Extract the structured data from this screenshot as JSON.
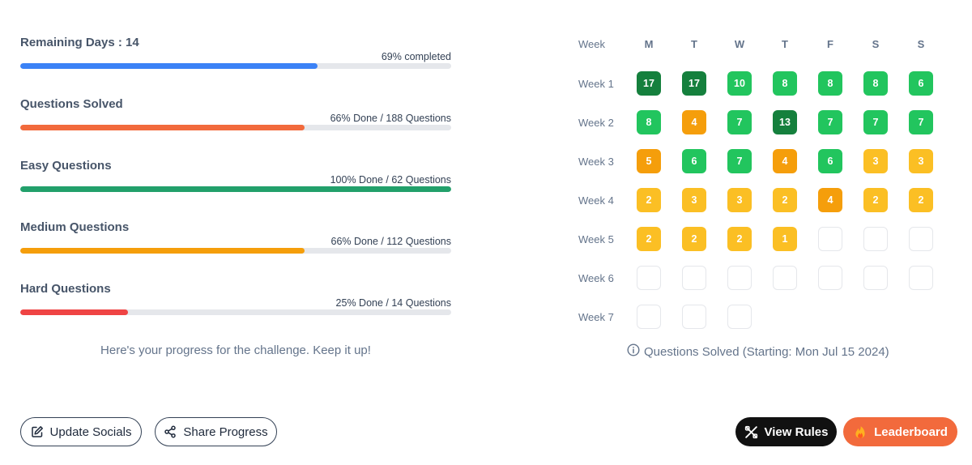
{
  "progress": [
    {
      "title": "Remaining Days : 14",
      "subtitle": "69% completed",
      "percent": 69,
      "color": "#3b82f6"
    },
    {
      "title": "Questions Solved",
      "subtitle": "66% Done / 188 Questions",
      "percent": 66,
      "color": "#f26a3c"
    },
    {
      "title": "Easy Questions",
      "subtitle": "100% Done / 62 Questions",
      "percent": 100,
      "color": "#22a06b"
    },
    {
      "title": "Medium Questions",
      "subtitle": "66% Done / 112 Questions",
      "percent": 66,
      "color": "#f59e0b"
    },
    {
      "title": "Hard Questions",
      "subtitle": "25% Done / 14 Questions",
      "percent": 25,
      "color": "#ef4444"
    }
  ],
  "encouragement": "Here's your progress for the challenge. Keep it up!",
  "calendar": {
    "header_label": "Week",
    "days": [
      "M",
      "T",
      "W",
      "T",
      "F",
      "S",
      "S"
    ],
    "weeks": [
      {
        "label": "Week 1",
        "cells": [
          {
            "v": "17",
            "l": "dark"
          },
          {
            "v": "17",
            "l": "dark"
          },
          {
            "v": "10",
            "l": "green"
          },
          {
            "v": "8",
            "l": "green"
          },
          {
            "v": "8",
            "l": "green"
          },
          {
            "v": "8",
            "l": "green"
          },
          {
            "v": "6",
            "l": "green"
          }
        ]
      },
      {
        "label": "Week 2",
        "cells": [
          {
            "v": "8",
            "l": "green"
          },
          {
            "v": "4",
            "l": "orange"
          },
          {
            "v": "7",
            "l": "green"
          },
          {
            "v": "13",
            "l": "dark"
          },
          {
            "v": "7",
            "l": "green"
          },
          {
            "v": "7",
            "l": "green"
          },
          {
            "v": "7",
            "l": "green"
          }
        ]
      },
      {
        "label": "Week 3",
        "cells": [
          {
            "v": "5",
            "l": "orange"
          },
          {
            "v": "6",
            "l": "green"
          },
          {
            "v": "7",
            "l": "green"
          },
          {
            "v": "4",
            "l": "orange"
          },
          {
            "v": "6",
            "l": "green"
          },
          {
            "v": "3",
            "l": "yellow"
          },
          {
            "v": "3",
            "l": "yellow"
          }
        ]
      },
      {
        "label": "Week 4",
        "cells": [
          {
            "v": "2",
            "l": "yellow"
          },
          {
            "v": "3",
            "l": "yellow"
          },
          {
            "v": "3",
            "l": "yellow"
          },
          {
            "v": "2",
            "l": "yellow"
          },
          {
            "v": "4",
            "l": "orange"
          },
          {
            "v": "2",
            "l": "yellow"
          },
          {
            "v": "2",
            "l": "yellow"
          }
        ]
      },
      {
        "label": "Week 5",
        "cells": [
          {
            "v": "2",
            "l": "yellow"
          },
          {
            "v": "2",
            "l": "yellow"
          },
          {
            "v": "2",
            "l": "yellow"
          },
          {
            "v": "1",
            "l": "yellow"
          },
          {
            "v": "",
            "l": "empty"
          },
          {
            "v": "",
            "l": "empty"
          },
          {
            "v": "",
            "l": "empty"
          }
        ]
      },
      {
        "label": "Week 6",
        "cells": [
          {
            "v": "",
            "l": "empty"
          },
          {
            "v": "",
            "l": "empty"
          },
          {
            "v": "",
            "l": "empty"
          },
          {
            "v": "",
            "l": "empty"
          },
          {
            "v": "",
            "l": "empty"
          },
          {
            "v": "",
            "l": "empty"
          },
          {
            "v": "",
            "l": "empty"
          }
        ]
      },
      {
        "label": "Week 7",
        "cells": [
          {
            "v": "",
            "l": "empty"
          },
          {
            "v": "",
            "l": "empty"
          },
          {
            "v": "",
            "l": "empty"
          }
        ]
      }
    ],
    "caption": "Questions Solved (Starting: Mon Jul 15 2024)",
    "caption_icon": "info-icon"
  },
  "buttons": {
    "update_socials": {
      "label": "Update Socials",
      "icon": "edit-icon"
    },
    "share_progress": {
      "label": "Share Progress",
      "icon": "share-icon"
    },
    "view_rules": {
      "label": "View Rules",
      "icon": "tools-icon"
    },
    "leaderboard": {
      "label": "Leaderboard",
      "icon": "fire-icon"
    }
  },
  "colors": {
    "cell_dark": "#15803d",
    "cell_green": "#22c55e",
    "cell_orange": "#f59e0b",
    "cell_yellow": "#fbbf24",
    "leaderboard_bg": "#f26a3c",
    "view_rules_bg": "#111111"
  }
}
